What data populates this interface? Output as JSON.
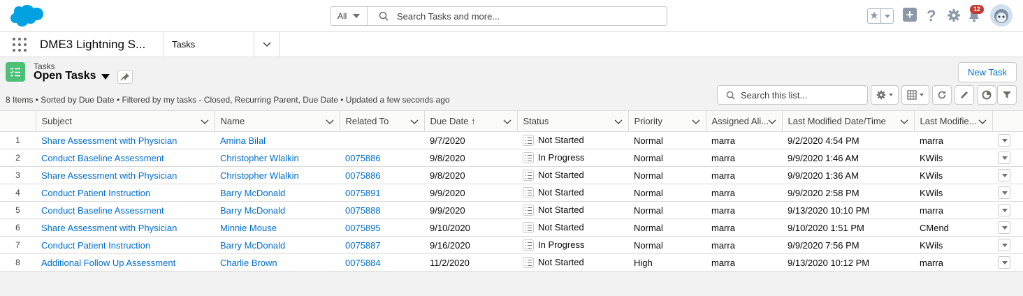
{
  "header": {
    "search_scope": "All",
    "search_placeholder": "Search Tasks and more...",
    "notification_count": "12"
  },
  "nav": {
    "app_name": "DME3 Lightning S...",
    "tab_label": "Tasks"
  },
  "list": {
    "object_label": "Tasks",
    "title": "Open Tasks",
    "new_button": "New Task",
    "meta": "8 Items • Sorted by Due Date • Filtered by my tasks - Closed, Recurring Parent, Due Date • Updated a few seconds ago",
    "search_placeholder": "Search this list..."
  },
  "columns": [
    "Subject",
    "Name",
    "Related To",
    "Due Date ↑",
    "Status",
    "Priority",
    "Assigned Ali...",
    "Last Modified Date/Time",
    "Last Modifie..."
  ],
  "rows": [
    {
      "num": "1",
      "subject": "Share Assessment with Physician",
      "name": "Amina Bilal",
      "related": "",
      "due": "9/7/2020",
      "status": "Not Started",
      "priority": "Normal",
      "assigned": "marra",
      "modified": "9/2/2020 4:54 PM",
      "modified_by": "marra"
    },
    {
      "num": "2",
      "subject": "Conduct Baseline Assessment",
      "name": "Christopher Wlalkin",
      "related": "0075886",
      "due": "9/8/2020",
      "status": "In Progress",
      "priority": "Normal",
      "assigned": "marra",
      "modified": "9/9/2020 1:46 AM",
      "modified_by": "KWils"
    },
    {
      "num": "3",
      "subject": "Share Assessment with Physician",
      "name": "Christopher Wlalkin",
      "related": "0075886",
      "due": "9/8/2020",
      "status": "Not Started",
      "priority": "Normal",
      "assigned": "marra",
      "modified": "9/9/2020 1:36 AM",
      "modified_by": "KWils"
    },
    {
      "num": "4",
      "subject": "Conduct Patient Instruction",
      "name": "Barry McDonald",
      "related": "0075891",
      "due": "9/9/2020",
      "status": "Not Started",
      "priority": "Normal",
      "assigned": "marra",
      "modified": "9/9/2020 2:58 PM",
      "modified_by": "KWils"
    },
    {
      "num": "5",
      "subject": "Conduct Baseline Assessment",
      "name": "Barry McDonald",
      "related": "0075888",
      "due": "9/9/2020",
      "status": "Not Started",
      "priority": "Normal",
      "assigned": "marra",
      "modified": "9/13/2020 10:10 PM",
      "modified_by": "marra"
    },
    {
      "num": "6",
      "subject": "Share Assessment with Physician",
      "name": "Minnie Mouse",
      "related": "0075895",
      "due": "9/10/2020",
      "status": "Not Started",
      "priority": "Normal",
      "assigned": "marra",
      "modified": "9/10/2020 1:51 PM",
      "modified_by": "CMend"
    },
    {
      "num": "7",
      "subject": "Conduct Patient Instruction",
      "name": "Barry McDonald",
      "related": "0075887",
      "due": "9/16/2020",
      "status": "In Progress",
      "priority": "Normal",
      "assigned": "marra",
      "modified": "9/9/2020 7:56 PM",
      "modified_by": "KWils"
    },
    {
      "num": "8",
      "subject": "Additional Follow Up Assessment",
      "name": "Charlie Brown",
      "related": "0075884",
      "due": "11/2/2020",
      "status": "Not Started",
      "priority": "High",
      "assigned": "marra",
      "modified": "9/13/2020 10:12 PM",
      "modified_by": "marra"
    }
  ]
}
